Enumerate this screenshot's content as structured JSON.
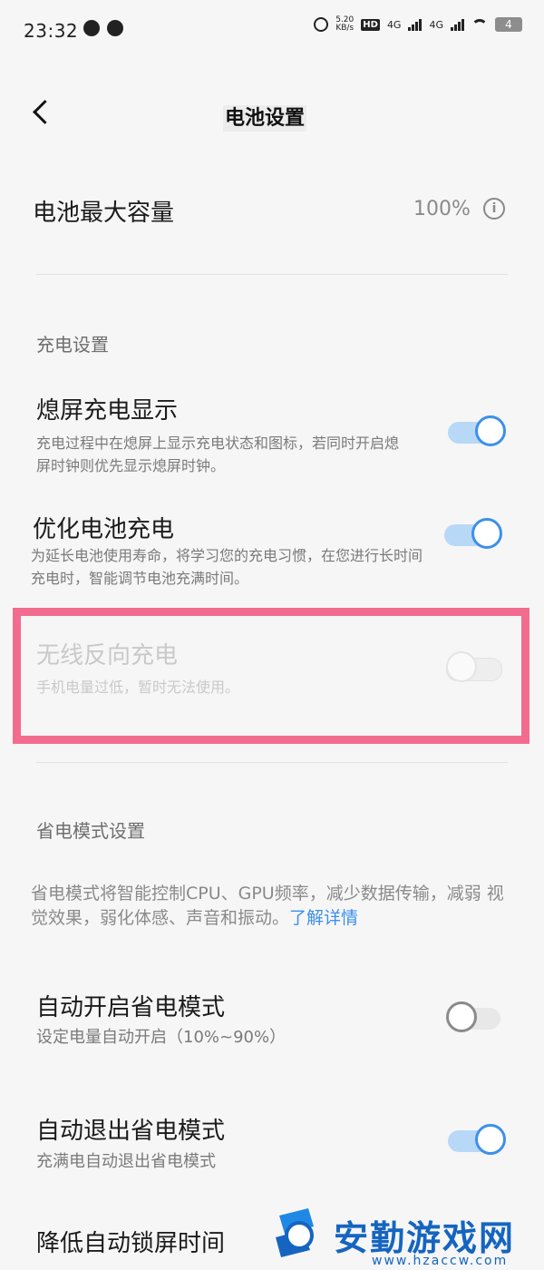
{
  "status_bar": {
    "time": "23:32",
    "net_speed_value": "5.20",
    "net_speed_unit": "KB/s",
    "hd_label": "HD",
    "sim1": "4G",
    "sim2": "4G",
    "battery": "4"
  },
  "header": {
    "title": "电池设置"
  },
  "battery_capacity": {
    "label": "电池最大容量",
    "value": "100%"
  },
  "charging_section": {
    "title": "充电设置",
    "items": [
      {
        "title": "熄屏充电显示",
        "desc": "充电过程中在熄屏上显示充电状态和图标，若同时开启熄屏时钟则优先显示熄屏时钟。",
        "on": true
      },
      {
        "title": "优化电池充电",
        "desc": "为延长电池使用寿命，将学习您的充电习惯，在您进行长时间充电时，智能调节电池充满时间。",
        "on": true
      },
      {
        "title": "无线反向充电",
        "desc": "手机电量过低，暂时无法使用。",
        "on": false,
        "disabled": true
      }
    ]
  },
  "power_saving_section": {
    "title": "省电模式设置",
    "desc": "省电模式将智能控制CPU、GPU频率，减少数据传输，减弱 视觉效果，弱化体感、声音和振动。",
    "learn_more": "了解详情",
    "items": [
      {
        "title": "自动开启省电模式",
        "desc": "设定电量自动开启（10%~90%）",
        "on": false
      },
      {
        "title": "自动退出省电模式",
        "desc": "充满电自动退出省电模式",
        "on": true
      },
      {
        "title": "降低自动锁屏时间",
        "desc": "",
        "on": false
      }
    ]
  },
  "watermark": {
    "name": "安勤游戏网",
    "url": "www.hzaccw.com"
  },
  "colors": {
    "accent": "#3d90e9",
    "highlight": "#f26c90",
    "background": "#f6f6f6"
  }
}
